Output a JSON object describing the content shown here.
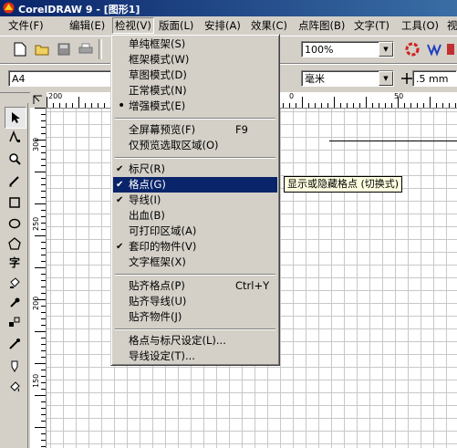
{
  "window": {
    "title": "CorelDRAW 9 - [图形1]"
  },
  "menubar": [
    {
      "label": "文件(F)"
    },
    {
      "label": "编辑(E)"
    },
    {
      "label": "检视(V)"
    },
    {
      "label": "版面(L)"
    },
    {
      "label": "安排(A)"
    },
    {
      "label": "效果(C)"
    },
    {
      "label": "点阵图(B)"
    },
    {
      "label": "文字(T)"
    },
    {
      "label": "工具(O)"
    },
    {
      "label": "视"
    }
  ],
  "toolbar": {
    "zoom_value": "100%"
  },
  "property_bar": {
    "paper_size": "A4",
    "units": "毫米",
    "nudge_value": ".5 mm"
  },
  "rulers": {
    "horizontal_labels": [
      "200",
      "0",
      "50"
    ],
    "vertical_labels": [
      "300",
      "250",
      "200",
      "150"
    ]
  },
  "view_menu": {
    "items": [
      {
        "label": "单纯框架(S)",
        "shortcut": "",
        "checked": false,
        "bullet": false
      },
      {
        "label": "框架模式(W)",
        "shortcut": "",
        "checked": false,
        "bullet": false
      },
      {
        "label": "草图模式(D)",
        "shortcut": "",
        "checked": false,
        "bullet": false
      },
      {
        "label": "正常模式(N)",
        "shortcut": "",
        "checked": false,
        "bullet": false
      },
      {
        "label": "增强模式(E)",
        "shortcut": "",
        "checked": false,
        "bullet": true
      },
      {
        "label": "全屏幕预览(F)",
        "shortcut": "F9",
        "checked": false,
        "bullet": false
      },
      {
        "label": "仅预览选取区域(O)",
        "shortcut": "",
        "checked": false,
        "bullet": false
      },
      {
        "label": "标尺(R)",
        "shortcut": "",
        "checked": true,
        "bullet": false
      },
      {
        "label": "格点(G)",
        "shortcut": "",
        "checked": true,
        "bullet": false,
        "highlighted": true
      },
      {
        "label": "导线(I)",
        "shortcut": "",
        "checked": true,
        "bullet": false
      },
      {
        "label": "出血(B)",
        "shortcut": "",
        "checked": false,
        "bullet": false
      },
      {
        "label": "可打印区域(A)",
        "shortcut": "",
        "checked": false,
        "bullet": false
      },
      {
        "label": "套印的物件(V)",
        "shortcut": "",
        "checked": true,
        "bullet": false
      },
      {
        "label": "文字框架(X)",
        "shortcut": "",
        "checked": false,
        "bullet": false
      },
      {
        "label": "贴齐格点(P)",
        "shortcut": "Ctrl+Y",
        "checked": false,
        "bullet": false
      },
      {
        "label": "贴齐导线(U)",
        "shortcut": "",
        "checked": false,
        "bullet": false
      },
      {
        "label": "贴齐物件(J)",
        "shortcut": "",
        "checked": false,
        "bullet": false
      },
      {
        "label": "格点与标尺设定(L)...",
        "shortcut": "",
        "checked": false,
        "bullet": false
      },
      {
        "label": "导线设定(T)...",
        "shortcut": "",
        "checked": false,
        "bullet": false
      }
    ],
    "check_mark": "✔",
    "bullet_mark": "•"
  },
  "tooltip": "显示或隐藏格点 (切换式)",
  "colors": {
    "highlight": "#0a246a",
    "face": "#d4d0c8",
    "tooltip_bg": "#ffffe1"
  },
  "icons": [
    "corel-logo-icon",
    "new-document-icon",
    "open-folder-icon",
    "save-icon",
    "print-icon",
    "cut-icon",
    "copy-icon",
    "paste-icon",
    "undo-icon",
    "redo-icon",
    "import-icon",
    "export-icon",
    "pick-tool-icon",
    "shape-tool-icon",
    "zoom-tool-icon",
    "freehand-tool-icon",
    "rectangle-tool-icon",
    "ellipse-tool-icon",
    "polygon-tool-icon",
    "text-tool-icon",
    "interactive-fill-icon",
    "eyedropper-icon",
    "outline-tool-icon",
    "fill-tool-icon"
  ]
}
